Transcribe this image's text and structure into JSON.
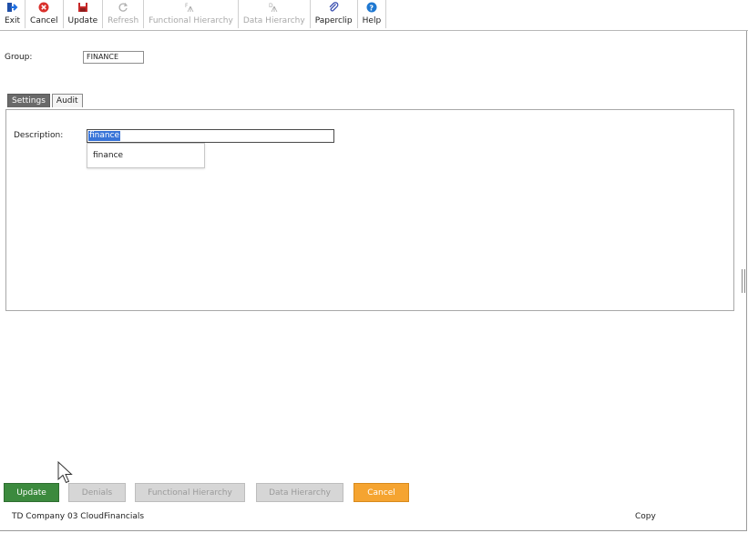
{
  "toolbar": {
    "items": [
      {
        "label": "Exit",
        "icon": "exit-icon",
        "enabled": true
      },
      {
        "label": "Cancel",
        "icon": "cancel-icon",
        "enabled": true
      },
      {
        "label": "Update",
        "icon": "save-icon",
        "enabled": true
      },
      {
        "label": "Refresh",
        "icon": "refresh-icon",
        "enabled": false
      },
      {
        "label": "Functional Hierarchy",
        "icon": "functional-hierarchy-icon",
        "enabled": false
      },
      {
        "label": "Data Hierarchy",
        "icon": "data-hierarchy-icon",
        "enabled": false
      },
      {
        "label": "Paperclip",
        "icon": "paperclip-icon",
        "enabled": true
      },
      {
        "label": "Help",
        "icon": "help-icon",
        "enabled": true
      }
    ]
  },
  "form": {
    "group_label": "Group:",
    "group_value": "FINANCE",
    "tabs": [
      {
        "label": "Settings",
        "active": true
      },
      {
        "label": "Audit",
        "active": false
      }
    ],
    "description_label": "Description:",
    "description_value": "finance",
    "autocomplete_items": [
      "finance"
    ]
  },
  "actions": {
    "update": "Update",
    "denials": "Denials",
    "functional_hierarchy": "Functional Hierarchy",
    "data_hierarchy": "Data Hierarchy",
    "cancel": "Cancel"
  },
  "footer": {
    "company": "TD Company 03 CloudFinancials",
    "copy": "Copy"
  },
  "colors": {
    "update_button": "#3c8a3e",
    "cancel_button": "#f5a431",
    "selection": "#3874d8",
    "active_tab": "#6a6a6a"
  }
}
